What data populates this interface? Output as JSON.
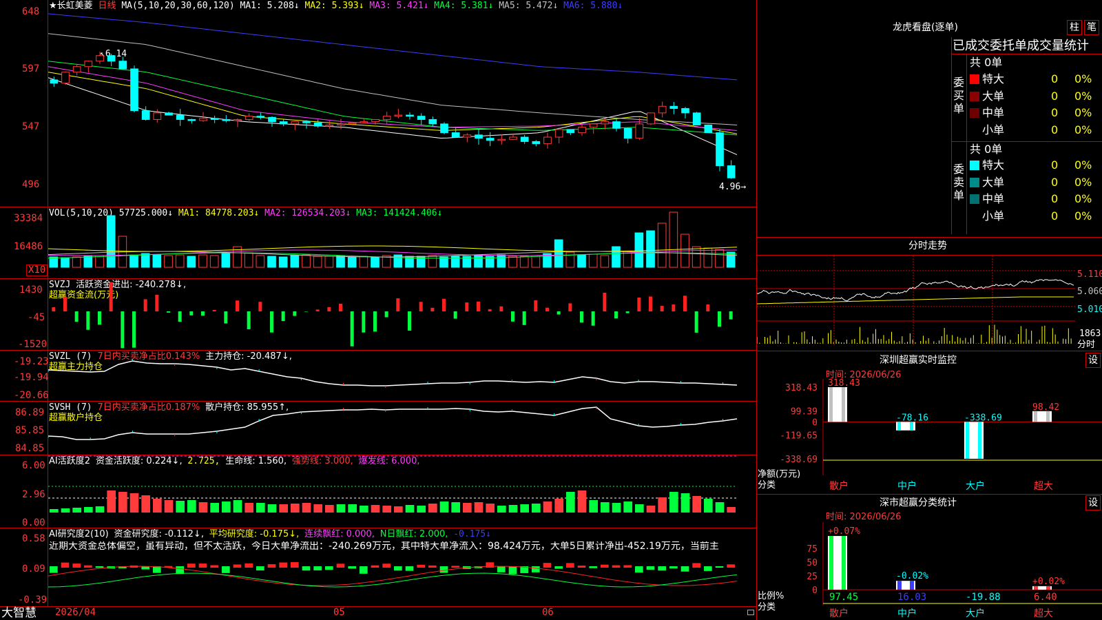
{
  "main": {
    "stock_name": "★长虹美菱",
    "period": "日线",
    "ma_label": "MA(5,10,20,30,60,120)",
    "ma_values": [
      {
        "name": "MA1: 5.208↓",
        "color": "#ffffff"
      },
      {
        "name": "MA2: 5.393↓",
        "color": "#ffff00"
      },
      {
        "name": "MA3: 5.421↓",
        "color": "#ff3cff"
      },
      {
        "name": "MA4: 5.381↓",
        "color": "#00ff3c"
      },
      {
        "name": "MA5: 5.472↓",
        "color": "#c0c0c0"
      },
      {
        "name": "MA6: 5.880↓",
        "color": "#3c3cff"
      }
    ],
    "y_ticks": [
      "648",
      "597",
      "547",
      "496"
    ],
    "high_note": "6.14",
    "low_note": "4.96"
  },
  "vol": {
    "header": "VOL(5,10,20)",
    "value": "57725.000↓",
    "ma1": "MA1: 84778.203↓",
    "ma2": "MA2: 126534.203↓",
    "ma3": "MA3: 141424.406↓",
    "y_ticks": [
      "33384",
      "16486"
    ],
    "unit": "X10"
  },
  "svzj": {
    "header": "SVZJ",
    "label": "活跃资金进出: -240.278↓,",
    "subtitle": "超赢资金流(万元)",
    "y_ticks": [
      "1430",
      "-45",
      "-1520"
    ]
  },
  "svzl": {
    "header": "SVZL (7)",
    "red_text": "7日内买卖净占比0.143%",
    "label": "主力持仓: -20.487↓,",
    "subtitle": "超赢主力持仓",
    "y_ticks": [
      "-19.23",
      "-19.94",
      "-20.66"
    ]
  },
  "svsh": {
    "header": "SVSH (7)",
    "red_text": "7日内买卖净占比0.187%",
    "label": "散户持仓: 85.955↑,",
    "subtitle": "超赢散户持仓",
    "y_ticks": [
      "86.89",
      "85.85",
      "84.85"
    ]
  },
  "ai1": {
    "header": "AI活跃度2",
    "label1": "资金活跃度: 0.224↓,",
    "label2": "2.725,",
    "label3": "生命线: 1.560,",
    "label4": "强势线: 3.000,",
    "label5": "爆发线: 6.000,",
    "y_ticks": [
      "6.00",
      "2.96",
      "0.00"
    ]
  },
  "ai2": {
    "header": "AI研究度2(10)",
    "label1": "资金研究度: -0.112↓,",
    "label2": "平均研究度: -0.175↓,",
    "label3": "连续飘红: 0.000,",
    "label4": "N日飘红: 2.000,",
    "label5": "-0.175↓",
    "commentary": "近期大资金总体偏空，虽有异动，但不太活跃，今日大单净流出：-240.269万元，其中特大单净流入：98.424万元，大单5日累计净出-452.19万元，当前主",
    "y_ticks": [
      "0.58",
      "0.09",
      "-0.39"
    ]
  },
  "footer": {
    "brand": "大智慧",
    "dates": [
      "2026/04",
      "05",
      "06"
    ]
  },
  "right": {
    "title": "龙虎看盘(逐单)",
    "btn_bar": "柱",
    "btn_pen": "笔",
    "stats_title": "已成交委托单成交量统计",
    "buy": {
      "side": "委买单",
      "total": "共 0单",
      "rows": [
        {
          "label": "特大",
          "count": "0",
          "pct": "0%",
          "color": "#ff0000"
        },
        {
          "label": "大单",
          "count": "0",
          "pct": "0%",
          "color": "#8b0000"
        },
        {
          "label": "中单",
          "count": "0",
          "pct": "0%",
          "color": "#6e0000"
        },
        {
          "label": "小单",
          "count": "0",
          "pct": "0%",
          "color": "#000000"
        }
      ]
    },
    "sell": {
      "side": "委卖单",
      "total": "共 0单",
      "rows": [
        {
          "label": "特大",
          "count": "0",
          "pct": "0%",
          "color": "#00ffff"
        },
        {
          "label": "大单",
          "count": "0",
          "pct": "0%",
          "color": "#008b8b"
        },
        {
          "label": "中单",
          "count": "0",
          "pct": "0%",
          "color": "#007070"
        },
        {
          "label": "小单",
          "count": "0",
          "pct": "0%",
          "color": "#000000"
        }
      ]
    },
    "intraday": {
      "title": "分时走势",
      "y_ticks": [
        "5.110",
        "5.060",
        "5.010"
      ],
      "vol_tick": "1863",
      "vol_unit": "分时"
    },
    "monitor": {
      "title": "深圳超赢实时监控",
      "btn": "设",
      "time": "时间: 2026/06/26",
      "y_ticks": [
        "318.43",
        "99.39",
        "0",
        "-119.65",
        "-338.69"
      ],
      "ylabel1": "净额(万元)",
      "ylabel2": "分类",
      "bars": [
        {
          "cat": "散户",
          "value": 318.43,
          "label": "318.43"
        },
        {
          "cat": "中户",
          "value": -78.16,
          "label": "-78.16"
        },
        {
          "cat": "大户",
          "value": -338.69,
          "label": "-338.69"
        },
        {
          "cat": "超大",
          "value": 98.42,
          "label": "98.42"
        }
      ]
    },
    "classify": {
      "title": "深市超赢分类统计",
      "btn": "设",
      "time": "时间: 2026/06/26",
      "y_ticks": [
        "75",
        "50",
        "25",
        "0"
      ],
      "ylabel1": "比例%",
      "ylabel2": "分类",
      "bars": [
        {
          "cat": "散户",
          "value": 97.45,
          "change": "+0.07%"
        },
        {
          "cat": "中户",
          "value": 16.03,
          "change": "-0.02%"
        },
        {
          "cat": "大户",
          "value": -19.88,
          "change": ""
        },
        {
          "cat": "超大",
          "value": 6.4,
          "change": "+0.02%"
        }
      ],
      "values_text": [
        "97.45",
        "16.03",
        "-19.88",
        "6.40"
      ]
    }
  }
}
